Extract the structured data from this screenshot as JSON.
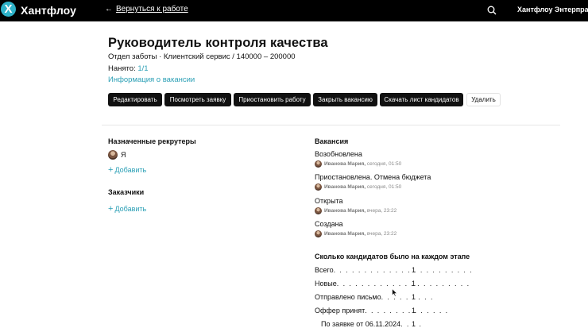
{
  "topbar": {
    "logo_letter": "X",
    "brand": "Хантфлоу",
    "back_label": "Вернуться к работе",
    "company": "Хантфлоу Энтерпрайз",
    "colors": {
      "bar": "#000000",
      "logo": "#2fb3c9"
    }
  },
  "vacancy": {
    "title": "Руководитель контроля качества",
    "meta": "Отдел заботы · Клиентский сервис / 140000 – 200000",
    "hired_label": "Нанято: ",
    "hired_value": "1/1",
    "info_link": "Информация о вакансии"
  },
  "actions": {
    "edit": "Редактировать",
    "view_request": "Посмотреть заявку",
    "pause": "Приостановить работу",
    "close": "Закрыть вакансию",
    "download": "Скачать лист кандидатов",
    "delete": "Удалить"
  },
  "recruiters": {
    "title": "Назначенные рекрутеры",
    "me": "Я",
    "add": "Добавить"
  },
  "customers": {
    "title": "Заказчики",
    "add": "Добавить"
  },
  "history": {
    "title": "Вакансия",
    "items": [
      {
        "status": "Возобновлена",
        "who": "Иванова Мария,",
        "when": "сегодня, 01:50"
      },
      {
        "status": "Приостановлена. Отмена бюджета",
        "who": "Иванова Мария,",
        "when": "сегодня, 01:50"
      },
      {
        "status": "Открыта",
        "who": "Иванова Мария,",
        "when": "вчера, 23:22"
      },
      {
        "status": "Создана",
        "who": "Иванова Мария,",
        "when": "вчера, 23:22"
      }
    ]
  },
  "stages": {
    "title": "Сколько кандидатов было на каждом этапе",
    "rows": [
      {
        "label": "Всего",
        "dots": ". . . . . . . . . . . . . . . . . . . . . . .",
        "value": "1"
      },
      {
        "label": "Новые",
        "dots": ". . . . . . . . . . . . . . . . . . . . . .",
        "value": "1"
      },
      {
        "label": "Отправлено письмо",
        "dots": ". . . . . . . . .",
        "value": "1"
      },
      {
        "label": "Оффер принят",
        "dots": ". . . . . . . . . . . . . .",
        "value": "1"
      },
      {
        "label": "По заявке от 06.11.2024",
        "dots": ". . . .",
        "value": "1"
      }
    ]
  }
}
